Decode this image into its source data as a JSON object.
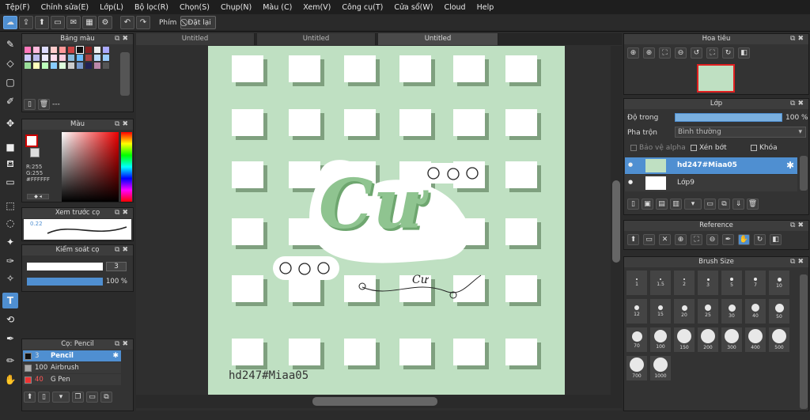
{
  "menu": [
    "Tệp(F)",
    "Chỉnh sửa(E)",
    "Lớp(L)",
    "Bộ lọc(R)",
    "Chọn(S)",
    "Chụp(N)",
    "Màu (C)",
    "Xem(V)",
    "Công cụ(T)",
    "Cửa sổ(W)",
    "Cloud",
    "Help"
  ],
  "toolbar": {
    "pen_label": "Phím",
    "reset_label": "Đặt lại"
  },
  "tabs": [
    "Untitled",
    "Untitled",
    "Untitled"
  ],
  "panels": {
    "palette": {
      "title": "Bảng màu",
      "footer": "---"
    },
    "color": {
      "title": "Màu",
      "r": "R:255",
      "g": "G:255",
      "hex": "#FFFFFF"
    },
    "brush_preview": {
      "title": "Xem trước cọ",
      "size": "0.22"
    },
    "brush_control": {
      "title": "Kiểm soát cọ",
      "size_value": "3",
      "opacity_value": "100 %"
    },
    "brush_list": {
      "title": "Cọ: Pencil",
      "items": [
        {
          "size": "3",
          "name": "Pencil",
          "selected": true
        },
        {
          "size": "100",
          "name": "Airbrush",
          "selected": false
        },
        {
          "size": "40",
          "name": "G Pen",
          "selected": false
        }
      ]
    },
    "navigator": {
      "title": "Hoa tiêu"
    },
    "layer": {
      "title": "Lớp",
      "opacity_label": "Độ trong",
      "opacity_value": "100 %",
      "blend_label": "Pha trộn",
      "blend_value": "Bình thường",
      "protect_alpha": "Bảo vệ alpha",
      "clipping": "Xén bớt",
      "lock": "Khóa",
      "layers": [
        {
          "name": "hd247#Miaa05",
          "selected": true
        },
        {
          "name": "Lớp9",
          "selected": false
        }
      ]
    },
    "reference": {
      "title": "Reference"
    },
    "brush_size": {
      "title": "Brush Size",
      "sizes": [
        "1",
        "1.5",
        "2",
        "3",
        "5",
        "7",
        "10",
        "12",
        "15",
        "20",
        "25",
        "30",
        "40",
        "50",
        "70",
        "100",
        "150",
        "200",
        "300",
        "400",
        "500",
        "700",
        "1000"
      ]
    }
  },
  "canvas": {
    "text_main": "Cư",
    "watermark": "hd247#Miaa05"
  },
  "colors": {
    "accent": "#4f8fd1",
    "canvas_bg": "#bfe0c2",
    "lettering": "#8fc490"
  }
}
